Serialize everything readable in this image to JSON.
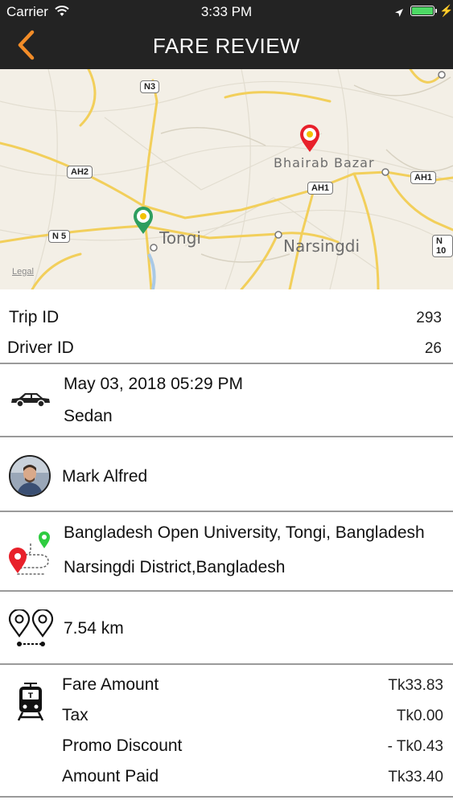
{
  "status_bar": {
    "carrier": "Carrier",
    "time": "3:33 PM"
  },
  "header": {
    "title": "FARE REVIEW"
  },
  "map": {
    "labels": {
      "tongi": "Tongi",
      "narsingdi": "Narsingdi",
      "bhairab": "Bhairab Bazar",
      "legal": "Legal"
    },
    "shields": {
      "n3": "N3",
      "ah2": "AH2",
      "n5": "N 5",
      "ah1_a": "AH1",
      "ah1_b": "AH1",
      "n10": "N 10"
    }
  },
  "trip": {
    "trip_id_label": "Trip ID",
    "trip_id": "293",
    "driver_id_label": "Driver ID",
    "driver_id": "26"
  },
  "vehicle": {
    "datetime": "May 03, 2018 05:29 PM",
    "type": "Sedan"
  },
  "driver": {
    "name": "Mark Alfred"
  },
  "route": {
    "pickup": "Bangladesh Open University, Tongi, Bangladesh",
    "dropoff": "Narsingdi District,Bangladesh"
  },
  "distance": {
    "value": "7.54 km"
  },
  "fare": {
    "items": [
      {
        "label": "Fare Amount",
        "value": "Tk33.83"
      },
      {
        "label": "Tax",
        "value": "Tk0.00"
      },
      {
        "label": "Promo Discount",
        "value": "- Tk0.43"
      },
      {
        "label": "Amount Paid",
        "value": "Tk33.40"
      }
    ]
  },
  "colors": {
    "accent": "#f28c28",
    "header_bg": "#232323",
    "pickup_pin": "#2e9e5f",
    "dropoff_pin": "#e8202a"
  }
}
